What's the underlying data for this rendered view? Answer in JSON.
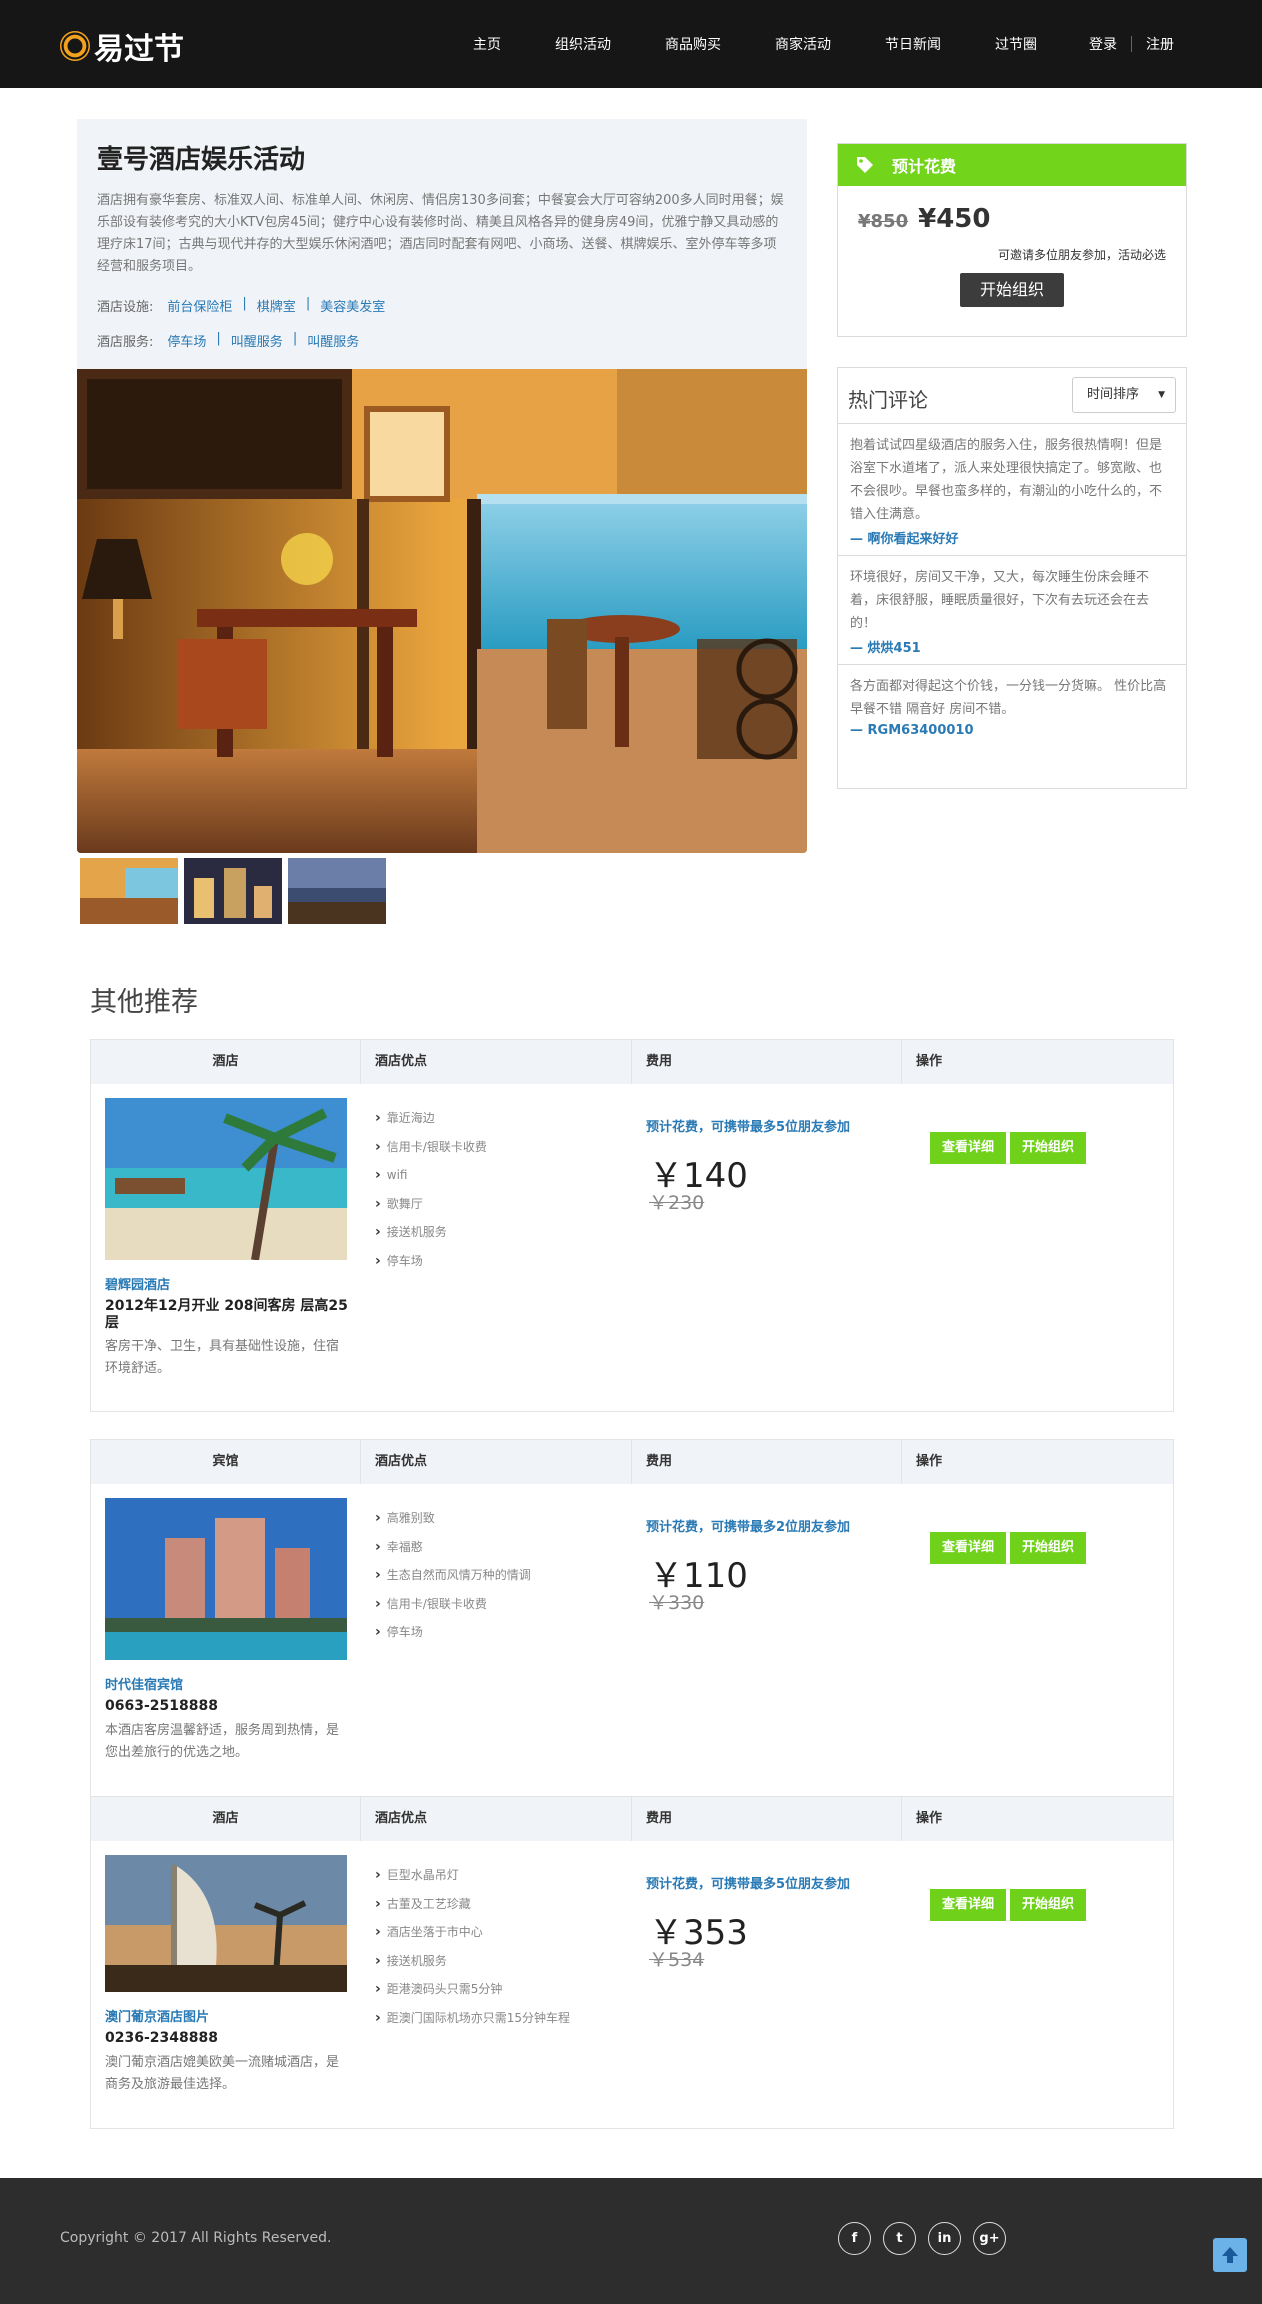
{
  "brand": {
    "name": "易过节"
  },
  "nav": {
    "items": [
      "主页",
      "组织活动",
      "商品购买",
      "商家活动",
      "节日新闻",
      "过节圈"
    ],
    "login": "登录",
    "register": "注册"
  },
  "hotel": {
    "title": "壹号酒店娱乐活动",
    "description": "酒店拥有豪华套房、标准双人间、标准单人间、休闲房、情侣房130多间套；中餐宴会大厅可容纳200多人同时用餐；娱乐部设有装修考究的大小KTV包房45间；健疗中心设有装修时尚、精美且风格各异的健身房49间，优雅宁静又具动感的理疗床17间；古典与现代并存的大型娱乐休闲酒吧；酒店同时配套有网吧、小商场、送餐、棋牌娱乐、室外停车等多项经营和服务项目。",
    "facilities_label": "酒店设施:",
    "facilities": [
      "前台保险柜",
      "棋牌室",
      "美容美发室"
    ],
    "services_label": "酒店服务:",
    "services": [
      "停车场",
      "叫醒服务",
      "叫醒服务"
    ]
  },
  "price_card": {
    "title": "预计花费",
    "old_price": "¥850",
    "new_price": "¥450",
    "invite_note": "可邀请多位朋友参加，活动必选",
    "start_button": "开始组织"
  },
  "reviews": {
    "title": "热门评论",
    "sort_label": "时间排序",
    "items": [
      {
        "text": "抱着试试四星级酒店的服务入住，服务很热情啊！但是浴室下水道堵了，派人来处理很快搞定了。够宽敞、也不会很吵。早餐也蛮多样的，有潮汕的小吃什么的，不错入住满意。",
        "author": "啊你看起来好好"
      },
      {
        "text": "环境很好，房间又干净，又大，每次睡生份床会睡不着，床很舒服，睡眠质量很好，下次有去玩还会在去的！",
        "author": "烘烘451"
      },
      {
        "text": "各方面都对得起这个价钱，一分钱一分货嘛。 性价比高 早餐不错 隔音好 房间不错。",
        "author": "RGM63400010"
      }
    ]
  },
  "other": {
    "title": "其他推荐",
    "col_features": "酒店优点",
    "col_fee": "费用",
    "col_ops": "操作",
    "detail_button": "查看详细",
    "start_button": "开始组织",
    "items": [
      {
        "type": "酒店",
        "name": "碧辉园酒店",
        "subtitle": "2012年12月开业 208间客房 层高25层",
        "desc": "客房干净、卫生，具有基础性设施，住宿环境舒适。",
        "features": [
          "靠近海边",
          "信用卡/银联卡收费",
          "wifi",
          "歌舞厅",
          "接送机服务",
          "停车场"
        ],
        "fee_note": "预计花费，可携带最多5位朋友参加",
        "price": "￥140",
        "old_price": "￥230"
      },
      {
        "type": "宾馆",
        "name": "时代佳宿宾馆",
        "subtitle": "0663-2518888",
        "desc": "本酒店客房温馨舒适，服务周到热情，是您出差旅行的优选之地。",
        "features": [
          "高雅别致",
          "幸福憨",
          "生态自然而风情万种的情调",
          "信用卡/银联卡收费",
          "停车场"
        ],
        "fee_note": "预计花费，可携带最多2位朋友参加",
        "price": "￥110",
        "old_price": "￥330"
      },
      {
        "type": "酒店",
        "name": "澳门葡京酒店图片",
        "subtitle": "0236-2348888",
        "desc": "澳门葡京酒店媲美欧美一流赌城酒店，是商务及旅游最佳选择。",
        "features": [
          "巨型水晶吊灯",
          "古董及工艺珍藏",
          "酒店坐落于市中心",
          "接送机服务",
          "距港澳码头只需5分钟",
          "距澳门国际机场亦只需15分钟车程"
        ],
        "fee_note": "预计花费，可携带最多5位朋友参加",
        "price": "￥353",
        "old_price": "￥534"
      }
    ]
  },
  "footer": {
    "copyright": "Copyright © 2017 All Rights Reserved.",
    "social_icons": [
      "facebook-icon",
      "twitter-icon",
      "linkedin-icon",
      "google-plus-icon"
    ]
  },
  "colors": {
    "accent_green": "#72d51c",
    "link_blue": "#2a7ab5",
    "header_bg": "#161616",
    "footer_bg": "#2d2d2d"
  }
}
